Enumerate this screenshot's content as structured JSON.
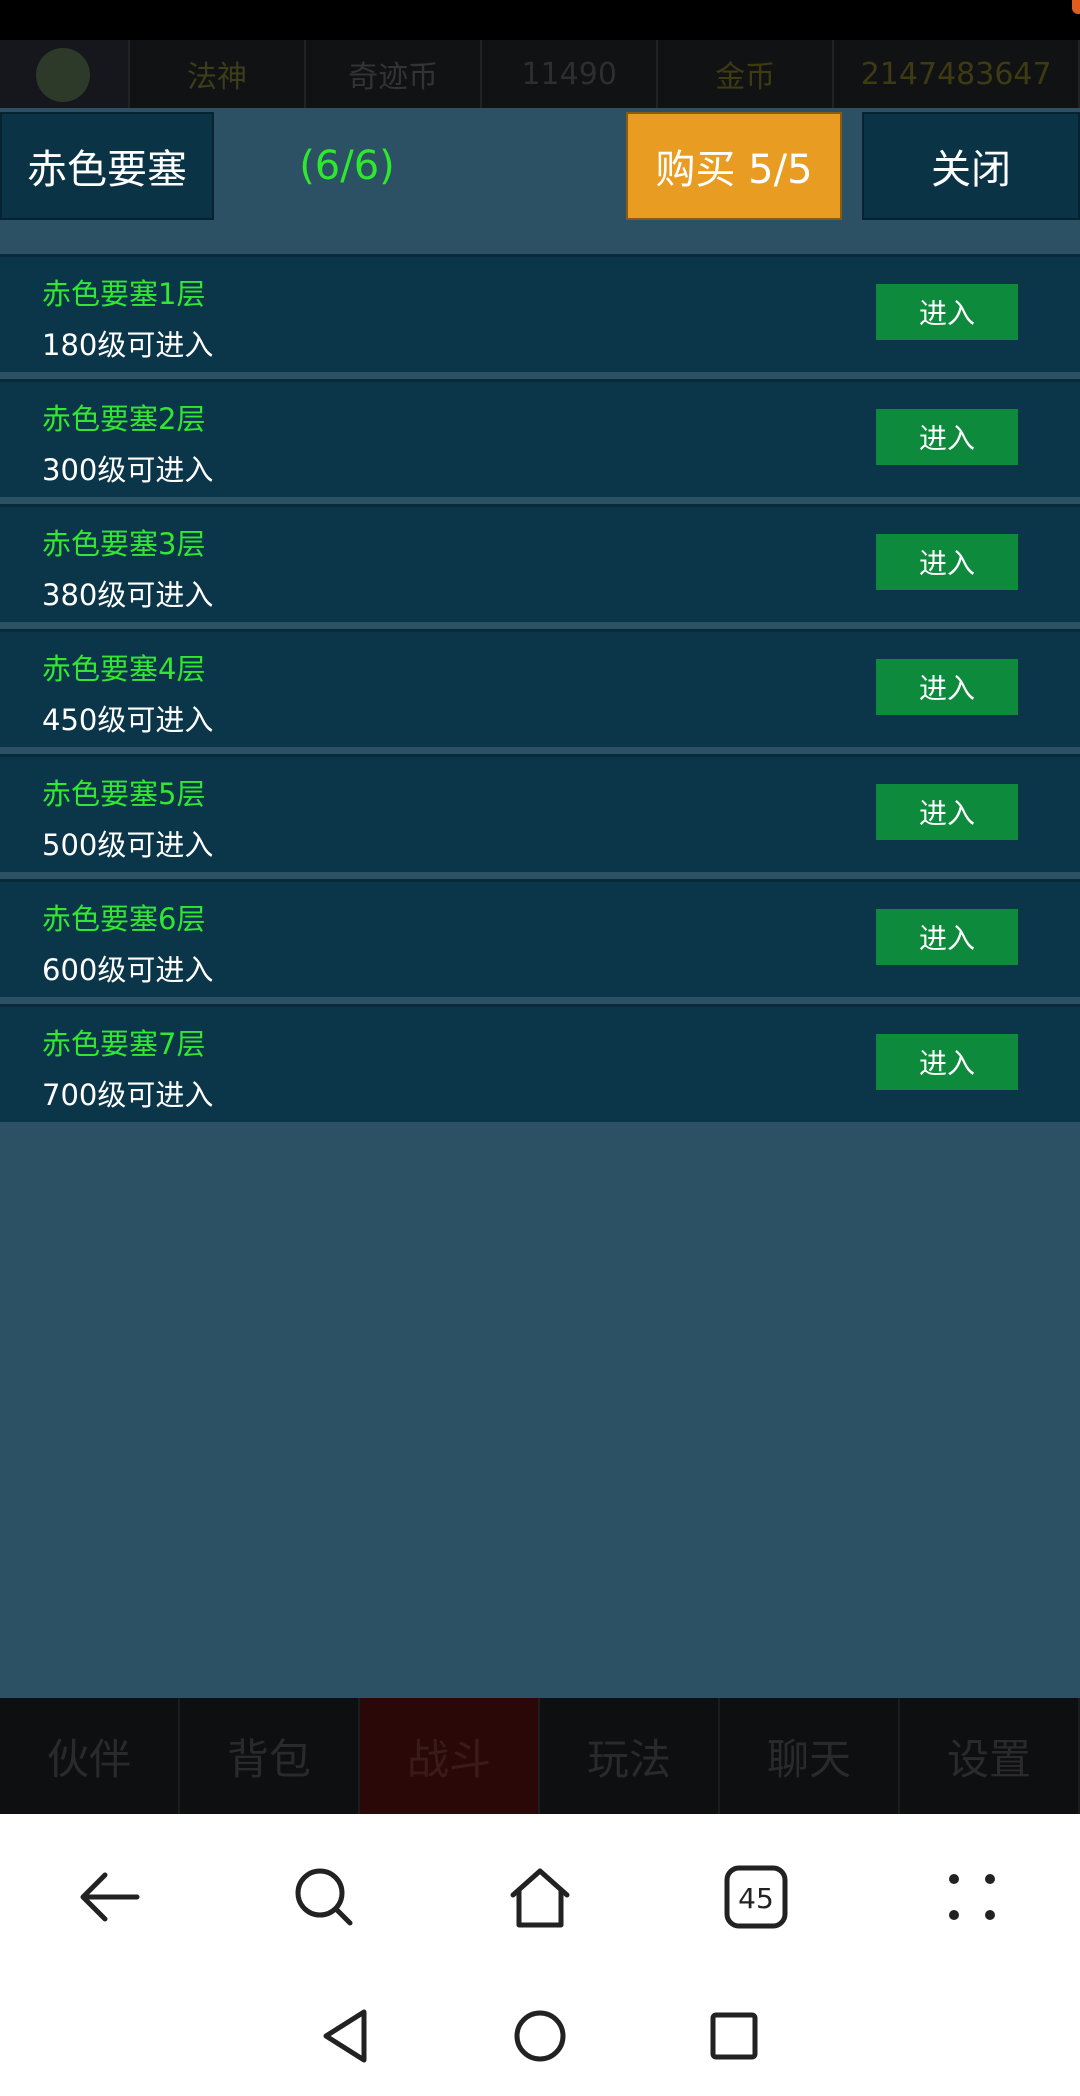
{
  "header": {
    "class_label": "法神",
    "miracle_label": "奇迹币",
    "miracle_value": "11490",
    "gold_label": "金币",
    "gold_value": "2147483647"
  },
  "panel": {
    "title": "赤色要塞",
    "count": "(6/6)",
    "buy_label": "购买 5/5",
    "close_label": "关闭"
  },
  "floors": [
    {
      "name": "赤色要塞1层",
      "requirement": "180级可进入",
      "button": "进入"
    },
    {
      "name": "赤色要塞2层",
      "requirement": "300级可进入",
      "button": "进入"
    },
    {
      "name": "赤色要塞3层",
      "requirement": "380级可进入",
      "button": "进入"
    },
    {
      "name": "赤色要塞4层",
      "requirement": "450级可进入",
      "button": "进入"
    },
    {
      "name": "赤色要塞5层",
      "requirement": "500级可进入",
      "button": "进入"
    },
    {
      "name": "赤色要塞6层",
      "requirement": "600级可进入",
      "button": "进入"
    },
    {
      "name": "赤色要塞7层",
      "requirement": "700级可进入",
      "button": "进入"
    }
  ],
  "tabs": [
    {
      "label": "伙伴"
    },
    {
      "label": "背包"
    },
    {
      "label": "战斗",
      "active": true
    },
    {
      "label": "玩法"
    },
    {
      "label": "聊天"
    },
    {
      "label": "设置"
    }
  ],
  "browser_nav": {
    "back_icon": "back-arrow-icon",
    "search_icon": "search-icon",
    "home_icon": "home-icon",
    "tabs_count": "45",
    "menu_icon": "more-dots-icon"
  },
  "system_nav": {
    "back_icon": "triangle-back-icon",
    "home_icon": "circle-home-icon",
    "recents_icon": "square-recents-icon"
  },
  "colors": {
    "panel_bg": "#2c5064",
    "row_bg": "#0b3549",
    "green_text": "#32e632",
    "enter_button": "#0d8a3c",
    "buy_button": "#e89c22"
  }
}
